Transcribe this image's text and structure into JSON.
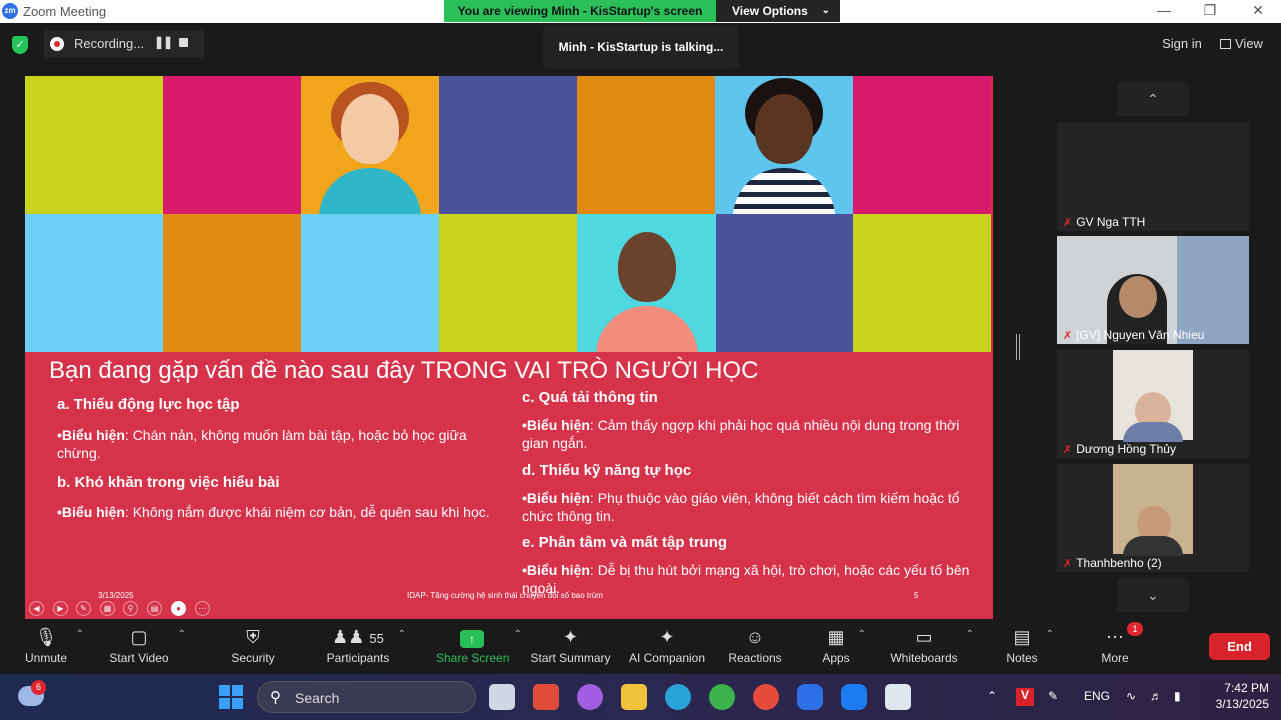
{
  "window": {
    "app_title": "Zoom Meeting",
    "logo": "zm",
    "minimize": "—",
    "maximize": "❐",
    "close": "✕"
  },
  "banner": {
    "viewing": "You are viewing Minh - KisStartup's screen",
    "view_options": "View Options"
  },
  "topbar": {
    "recording_label": "Recording...",
    "talking": "Minh - KisStartup is talking...",
    "sign_in": "Sign in",
    "view": "View"
  },
  "slide": {
    "title": "Bạn đang gặp vấn đề nào sau đây TRONG VAI TRÒ NGƯỜI HỌC",
    "sections": [
      {
        "heading": "a. Thiếu động lực học tập",
        "label": "•Biểu hiện",
        "text": ": Chán nản, không muốn làm bài tập, hoặc bỏ học giữa chừng."
      },
      {
        "heading": "b. Khó khăn trong việc hiểu bài",
        "label": "•Biểu hiện",
        "text": ": Không nắm được khái niệm cơ bản, dễ quên sau khi học."
      },
      {
        "heading": "c. Quá tải thông tin",
        "label": "•Biểu hiện",
        "text": ": Cảm thấy ngợp khi phải học quá nhiều nội dung trong thời gian ngắn."
      },
      {
        "heading": "d. Thiếu kỹ năng tự học",
        "label": "•Biểu hiện",
        "text": ": Phụ thuộc vào giáo viên, không biết cách tìm kiếm hoặc tổ chức thông tin."
      },
      {
        "heading": "e. Phân tâm và mất tập trung",
        "label": "•Biểu hiện",
        "text": ": Dễ bị thu hút bởi mạng xã hội, trò chơi, hoặc các yếu tố bên ngoài."
      }
    ],
    "footer_date": "3/13/2025",
    "footer_text": "IDAP- Tăng cường hệ sinh thái chuyển đổi số bao trùm",
    "page_number": "5",
    "tile_colors": [
      "#c9d21c",
      "#d91b6b",
      "#f0a51c",
      "#4a529c",
      "#e08a12",
      "#5fc4ee",
      "#d91b6b",
      "#6ccff5",
      "#e08a12",
      "#6ccff5",
      "#c9d21c",
      "#4fd8e0",
      "#4a529c",
      "#c9d21c"
    ]
  },
  "participants": [
    {
      "name": "GV Nga TTH"
    },
    {
      "name": "[GV] Nguyen Văn Nhieu"
    },
    {
      "name": "Dương Hồng Thủy"
    },
    {
      "name": "Thanhbenho (2)"
    }
  ],
  "toolbar": {
    "unmute": "Unmute",
    "start_video": "Start Video",
    "security": "Security",
    "participants": "Participants",
    "participant_count": "55",
    "share_screen": "Share Screen",
    "start_summary": "Start Summary",
    "ai_companion": "AI Companion",
    "reactions": "Reactions",
    "apps": "Apps",
    "whiteboards": "Whiteboards",
    "notes": "Notes",
    "more": "More",
    "more_badge": "1",
    "end": "End"
  },
  "taskbar": {
    "weather_badge": "6",
    "search": "Search",
    "lang": "ENG",
    "time": "7:42 PM",
    "date": "3/13/2025"
  },
  "colors": {
    "share_green": "#2bbf5a",
    "end_red": "#d8232a",
    "slide_red": "#d6334a"
  }
}
